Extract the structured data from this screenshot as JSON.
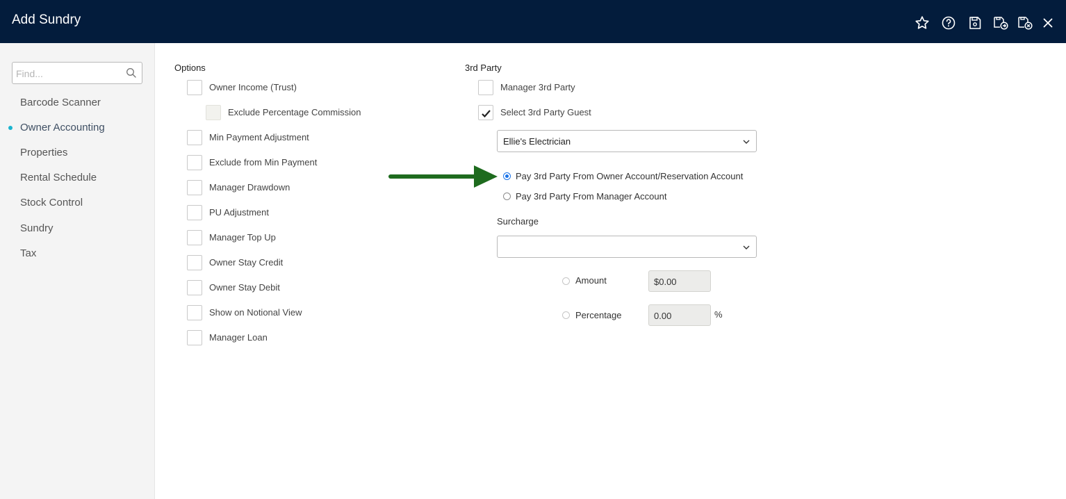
{
  "header": {
    "title": "Add Sundry",
    "tools": [
      {
        "name": "favourite-star-icon"
      },
      {
        "name": "help-icon"
      },
      {
        "name": "save-icon"
      },
      {
        "name": "save-and-new-icon"
      },
      {
        "name": "save-and-close-icon"
      },
      {
        "name": "close-icon"
      }
    ]
  },
  "sidebar": {
    "find_placeholder": "Find...",
    "find_value": "",
    "items": [
      {
        "label": "Barcode Scanner",
        "active": false
      },
      {
        "label": "Owner Accounting",
        "active": true
      },
      {
        "label": "Properties",
        "active": false
      },
      {
        "label": "Rental Schedule",
        "active": false
      },
      {
        "label": "Stock Control",
        "active": false
      },
      {
        "label": "Sundry",
        "active": false
      },
      {
        "label": "Tax",
        "active": false
      }
    ],
    "active_indicator_color": "#19b4cf"
  },
  "options": {
    "title": "Options",
    "items": [
      {
        "label": "Owner Income (Trust)",
        "checked": false,
        "disabled": false
      },
      {
        "label": "Exclude Percentage Commission",
        "checked": false,
        "disabled": true
      },
      {
        "label": "Min Payment Adjustment",
        "checked": false,
        "disabled": false
      },
      {
        "label": "Exclude from Min Payment",
        "checked": false,
        "disabled": false
      },
      {
        "label": "Manager Drawdown",
        "checked": false,
        "disabled": false
      },
      {
        "label": "PU Adjustment",
        "checked": false,
        "disabled": false
      },
      {
        "label": "Manager Top Up",
        "checked": false,
        "disabled": false
      },
      {
        "label": "Owner Stay Credit",
        "checked": false,
        "disabled": false
      },
      {
        "label": "Owner Stay Debit",
        "checked": false,
        "disabled": false
      },
      {
        "label": "Show on Notional View",
        "checked": false,
        "disabled": false
      },
      {
        "label": "Manager Loan",
        "checked": false,
        "disabled": false
      }
    ]
  },
  "third_party": {
    "title": "3rd Party",
    "manager_3rd_party": {
      "label": "Manager 3rd Party",
      "checked": false
    },
    "select_3rd_party_guest": {
      "label": "Select 3rd Party Guest",
      "checked": true
    },
    "guest_select_value": "Ellie's Electrician",
    "pay_options": [
      {
        "label": "Pay 3rd Party From Owner Account/Reservation Account",
        "selected": true
      },
      {
        "label": "Pay 3rd Party From Manager Account",
        "selected": false
      }
    ],
    "surcharge": {
      "label": "Surcharge",
      "select_value": "",
      "amount_label": "Amount",
      "amount_value": "$0.00",
      "percentage_label": "Percentage",
      "percentage_value": "0.00",
      "percentage_unit": "%"
    }
  },
  "annotation": {
    "color": "#1e6b1e"
  },
  "colors": {
    "header_bg": "#031c3c",
    "radio_selected": "#1a73e8"
  }
}
